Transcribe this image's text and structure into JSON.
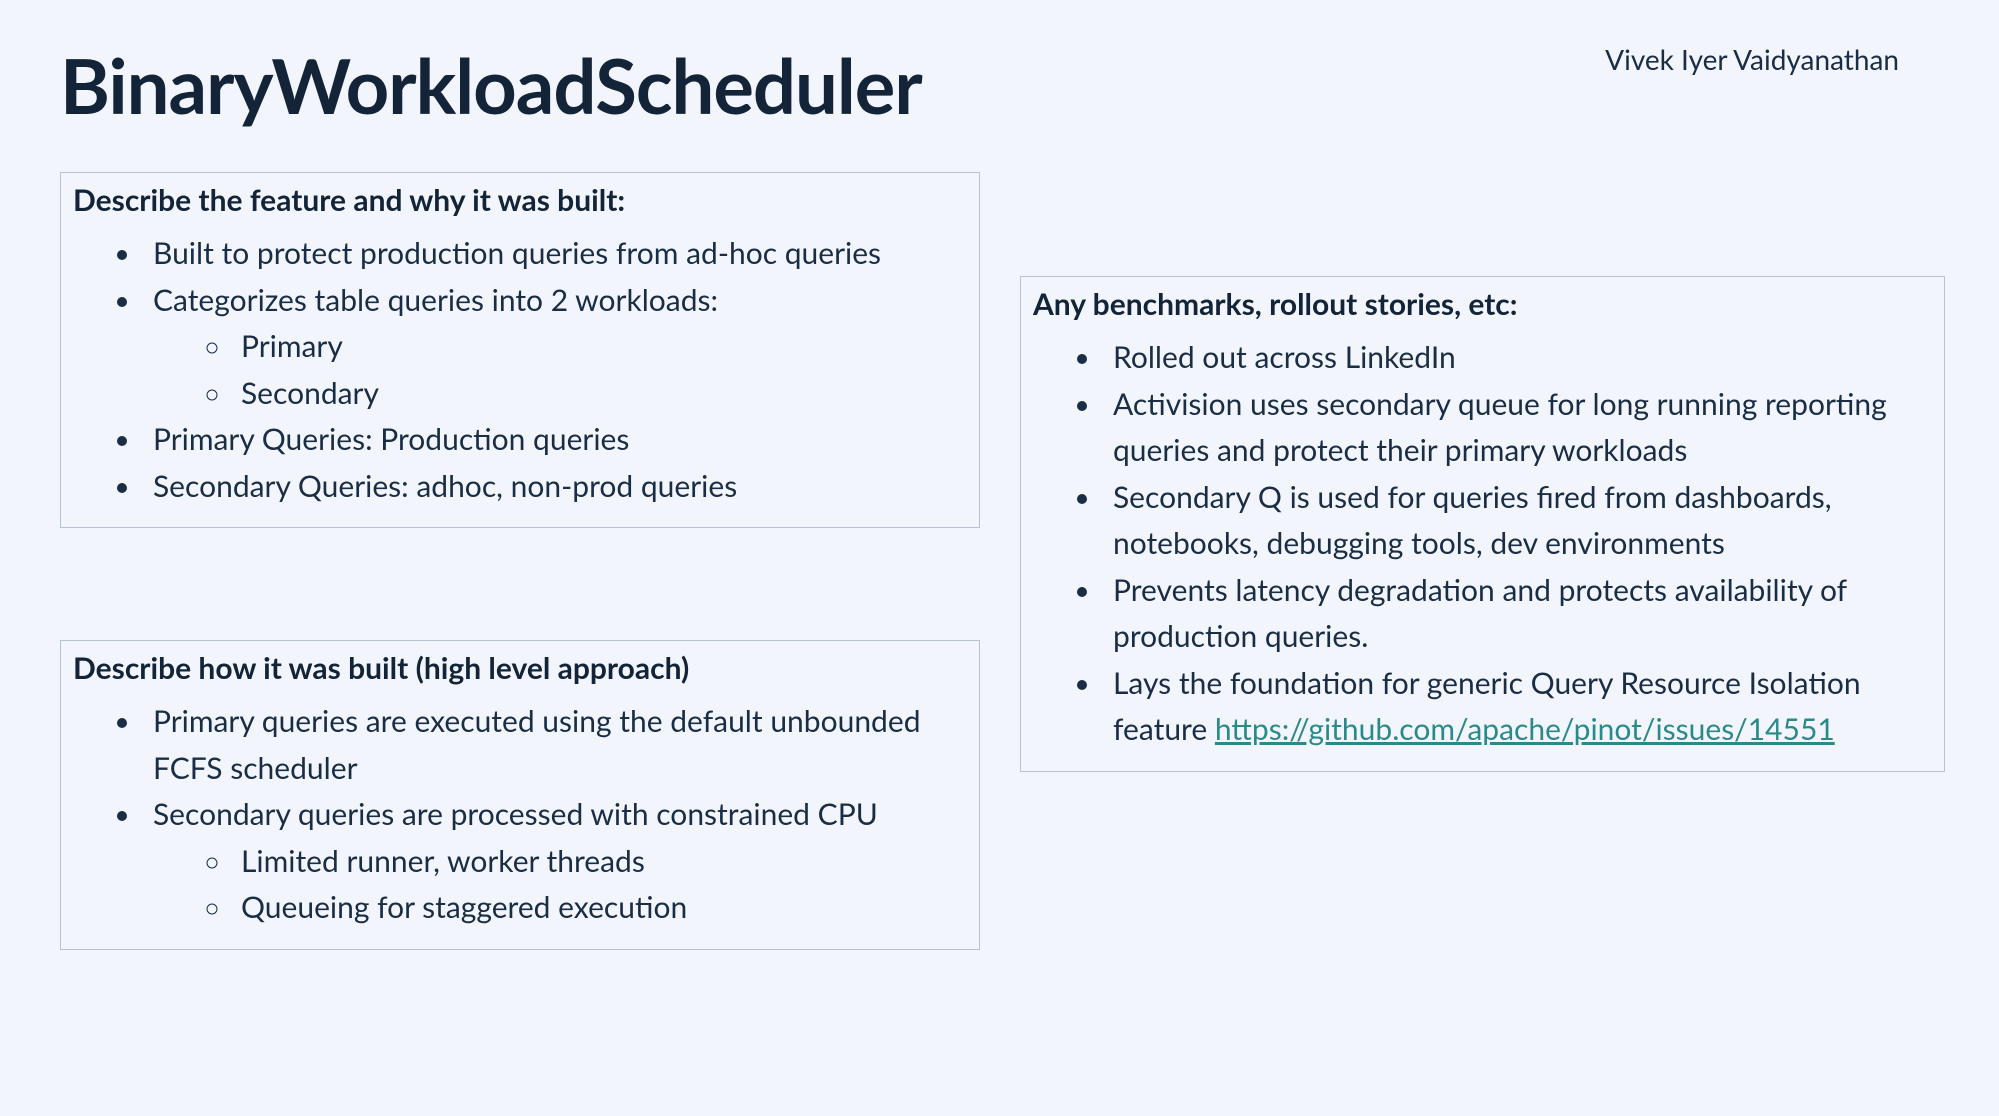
{
  "author": "Vivek Iyer Vaidyanathan",
  "title": "BinaryWorkloadScheduler",
  "box1": {
    "heading": "Describe the feature and why it was built:",
    "items": {
      "i0": "Built to protect production queries from ad-hoc queries",
      "i1": "Categorizes table queries into 2 workloads:",
      "i1_sub": {
        "s0": "Primary",
        "s1": "Secondary"
      },
      "i2": "Primary Queries: Production queries",
      "i3": "Secondary Queries: adhoc, non-prod queries"
    }
  },
  "box2": {
    "heading": "Describe how it was built (high level approach)",
    "items": {
      "i0": "Primary queries are executed using the default unbounded FCFS scheduler",
      "i1": "Secondary queries are processed with constrained CPU",
      "i1_sub": {
        "s0": "Limited runner, worker threads",
        "s1": "Queueing for staggered execution"
      }
    }
  },
  "box3": {
    "heading": "Any benchmarks, rollout stories, etc:",
    "items": {
      "i0": "Rolled out across LinkedIn",
      "i1": "Activision uses secondary queue for long running reporting queries and protect their primary workloads",
      "i2": "Secondary Q is used for queries fired from dashboards, notebooks, debugging tools, dev environments",
      "i3": "Prevents latency degradation and protects availability of production queries.",
      "i4_pre": "Lays the foundation for generic Query Resource Isolation feature ",
      "i4_link": "https://github.com/apache/pinot/issues/14551"
    }
  }
}
